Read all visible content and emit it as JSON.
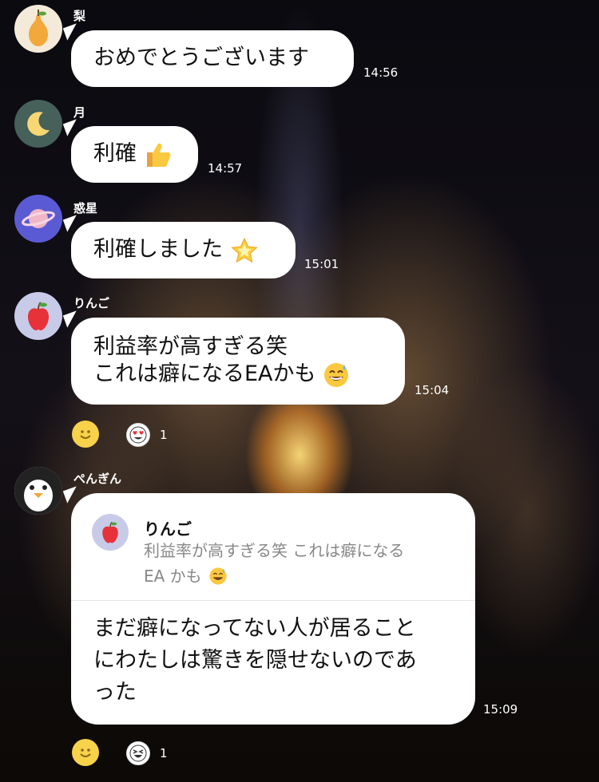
{
  "messages": [
    {
      "sender": "梨",
      "avatar_icon": "pear-icon",
      "text": "おめでとうございます",
      "time": "14:56"
    },
    {
      "sender": "月",
      "avatar_icon": "crescent-moon-icon",
      "text": "利確",
      "emoji": "thumbs-up-icon",
      "time": "14:57"
    },
    {
      "sender": "惑星",
      "avatar_icon": "planet-icon",
      "text": "利確しました",
      "emoji": "glowing-star-icon",
      "time": "15:01"
    },
    {
      "sender": "りんご",
      "avatar_icon": "apple-icon",
      "line1": "利益率が高すぎる笑",
      "line2": "これは癖になるEAかも",
      "emoji": "sweat-smile-icon",
      "time": "15:04",
      "reaction_count": "1"
    },
    {
      "sender": "ぺんぎん",
      "avatar_icon": "penguin-icon",
      "reply_to": {
        "sender": "りんご",
        "line1": "利益率が高すぎる笑 これは癖になる",
        "line2": "EA かも"
      },
      "line1": "まだ癖になってない人が居ること",
      "line2": "にわたしは驚きを隠せないのであ",
      "line3": "った",
      "time": "15:09",
      "reaction_count": "1"
    }
  ],
  "colors": {
    "bubble": "#ffffff",
    "text": "#111111",
    "timestamp": "#ffffff",
    "reply_gray": "#888888"
  }
}
